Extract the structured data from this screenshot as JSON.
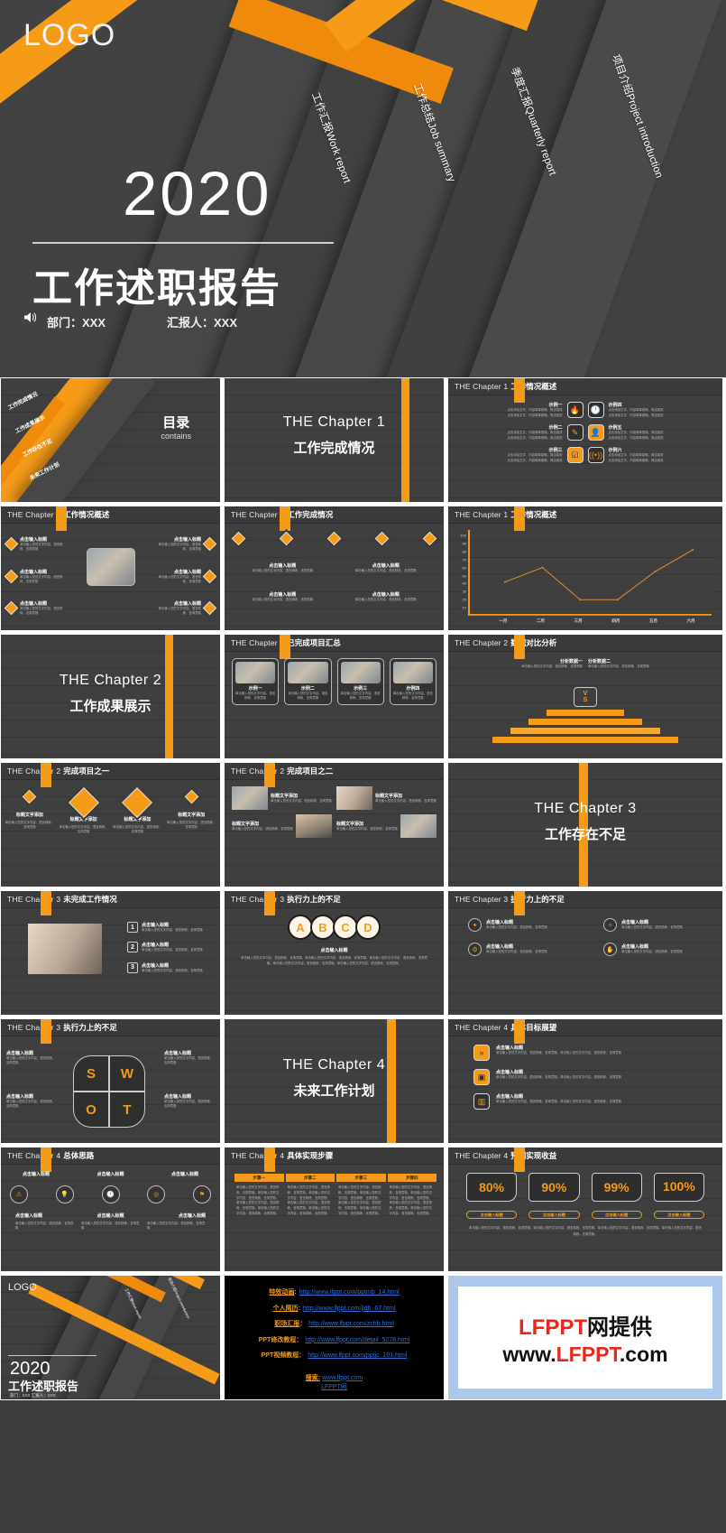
{
  "hero": {
    "logo": "LOGO",
    "year": "2020",
    "title": "工作述职报告",
    "dept_label": "部门：XXX",
    "reporter_label": "汇报人：XXX",
    "speaker_icon": "speaker-icon",
    "diagonal_labels": [
      "工作汇报Work report",
      "工作总结Job summary",
      "季度汇报Quarterly report",
      "项目介绍Project introduction"
    ],
    "accent_color": "#F59B18",
    "bg_color": "#424242"
  },
  "slides": [
    {
      "kind": "toc",
      "heading_cn": "目录",
      "heading_en": "contains",
      "items": [
        "工作完成情况",
        "工作成果展示",
        "工作存在不足",
        "未来工作计划"
      ]
    },
    {
      "kind": "chapter",
      "en": "THE Chapter 1",
      "cn": "工作完成情况"
    },
    {
      "kind": "overview-6",
      "chapter": "THE Chapter 1",
      "title": "工作情况概述",
      "items": [
        {
          "label": "示例一",
          "icon": "fire-icon",
          "body": "点击添加文字，内容简单易懂，简洁易改\n点击添加文字，内容简单易懂，简洁易改"
        },
        {
          "label": "示例二",
          "icon": "pencil-icon",
          "body": "点击添加文字，内容简单易懂，简洁易改\n点击添加文字，内容简单易懂，简洁易改"
        },
        {
          "label": "示例三",
          "icon": "checklist-icon",
          "body": "点击添加文字，内容简单易懂，简洁易改\n点击添加文字，内容简单易懂，简洁易改"
        },
        {
          "label": "示例四",
          "icon": "clock-24h-icon",
          "body": "点击添加文字，内容简单易懂，简洁易改\n点击添加文字，内容简单易懂，简洁易改"
        },
        {
          "label": "示例五",
          "icon": "user-check-icon",
          "body": "点击添加文字，内容简单易懂，简洁易改\n点击添加文字，内容简单易懂，简洁易改"
        },
        {
          "label": "示例六",
          "icon": "wifi-signal-icon",
          "body": "点击添加文字，内容简单易懂，简洁易改\n点击添加文字，内容简单易懂，简洁易改"
        }
      ]
    },
    {
      "kind": "diamond-4-photo",
      "chapter": "THE Chapter 1",
      "title": "工作情况概述",
      "item_title": "点击输入标题",
      "item_body": "单击输入您的文字内容，语言精练、言简意赅",
      "photo": "laptop-desk-photo"
    },
    {
      "kind": "diamond-row-5",
      "chapter": "THE Chapter 1",
      "title": "工作完成情况",
      "item_title": "点击输入标题",
      "item_body": "单击输入您的文字内容，语言精练、言简意赅"
    },
    {
      "kind": "line-chart",
      "chapter": "THE Chapter 1",
      "title": "工作情况概述"
    },
    {
      "kind": "chapter",
      "en": "THE Chapter 2",
      "cn": "工作成果展示"
    },
    {
      "kind": "cards-4",
      "chapter": "THE Chapter 2",
      "title": "已完成项目汇总",
      "cards": [
        {
          "label": "示例一",
          "photo": "city-desk-photo"
        },
        {
          "label": "示例二",
          "photo": "city-desk-photo"
        },
        {
          "label": "示例三",
          "photo": "city-desk-photo"
        },
        {
          "label": "示例四",
          "photo": "city-desk-photo"
        }
      ],
      "card_body": "单击输入您的文字内容，语言精练、言简意赅"
    },
    {
      "kind": "funnel",
      "chapter": "THE Chapter 2",
      "title": "数据对比分析",
      "col1_title": "分析数据一",
      "col2_title": "分析数据二",
      "col_body": "单击输入您的文字内容，语言精练、言简意赅",
      "center_letters": [
        "V",
        "S"
      ]
    },
    {
      "kind": "icon-4",
      "chapter": "THE Chapter 2",
      "title": "完成项目之一",
      "items": [
        {
          "icon": "diamond-small-icon",
          "title": "标题文字添加",
          "body": "单击输入您的文字内容，语言精练、言简意赅"
        },
        {
          "icon": "tag-money-icon",
          "title": "标题文字添加",
          "body": "单击输入您的文字内容，语言精练、言简意赅"
        },
        {
          "icon": "grid-dots-icon",
          "title": "标题文字添加",
          "body": "单击输入您的文字内容，语言精练、言简意赅"
        },
        {
          "icon": "diamond-small-icon",
          "title": "标题文字添加",
          "body": "单击输入您的文字内容，语言精练、言简意赅"
        }
      ]
    },
    {
      "kind": "photo-grid-4",
      "chapter": "THE Chapter 2",
      "title": "完成项目之二",
      "items": [
        {
          "title": "标题文字添加",
          "body": "单击输入您的文字内容，语言精练、言简意赅",
          "photo": "office-meeting-photo"
        },
        {
          "title": "标题文字添加",
          "body": "单击输入您的文字内容，语言精练、言简意赅",
          "photo": "team-photo"
        },
        {
          "title": "标题文字添加",
          "body": "单击输入您的文字内容，语言精练、言简意赅",
          "photo": "sunset-desk-photo"
        },
        {
          "title": "标题文字添加",
          "body": "单击输入您的文字内容，语言精练、言简意赅",
          "photo": "tablet-hands-photo"
        }
      ]
    },
    {
      "kind": "chapter",
      "en": "THE Chapter 3",
      "cn": "工作存在不足"
    },
    {
      "kind": "numbered-3-photo",
      "chapter": "THE Chapter 3",
      "title": "未完成工作情况",
      "photo": "writing-hands-photo",
      "items": [
        {
          "num": "1",
          "title": "点击输入标题",
          "body": "单击输入您的文字内容，语言精练、言简意赅"
        },
        {
          "num": "2",
          "title": "点击输入标题",
          "body": "单击输入您的文字内容，语言精练、言简意赅"
        },
        {
          "num": "3",
          "title": "点击输入标题",
          "body": "单击输入您的文字内容，语言精练、言简意赅"
        }
      ]
    },
    {
      "kind": "abcd",
      "chapter": "THE Chapter 3",
      "title": "执行力上的不足",
      "letters": [
        "A",
        "B",
        "C",
        "D"
      ],
      "body_title": "点击输入标题",
      "body": "单击输入您的文字内容，语言精练、言简意赅。单击输入您的文字内容，语言精练、言简意赅。单击输入您的文字内容，语言精练、言简意赅。单击输入您的文字内容，语言精练、言简意赅。单击输入您的文字内容，语言精练、言简意赅。"
    },
    {
      "kind": "circ-icons-4",
      "chapter": "THE Chapter 3",
      "title": "执行力上的不足",
      "items": [
        {
          "icon": "puzzle-icon",
          "title": "点击输入标题",
          "body": "单击输入您的文字内容，语言精练、言简意赅"
        },
        {
          "icon": "gears-icon",
          "title": "点击输入标题",
          "body": "单击输入您的文字内容，语言精练、言简意赅"
        },
        {
          "icon": "handshake-icon",
          "title": "点击输入标题",
          "body": "单击输入您的文字内容，语言精练、言简意赅"
        },
        {
          "icon": "hand-idea-icon",
          "title": "点击输入标题",
          "body": "单击输入您的文字内容，语言精练、言简意赅"
        }
      ]
    },
    {
      "kind": "swot",
      "chapter": "THE Chapter 3",
      "title": "执行力上的不足",
      "letters": [
        "S",
        "W",
        "O",
        "T"
      ],
      "item_title": "点击输入标题",
      "item_body": "单击输入您的文字内容，语言精练、言简意赅"
    },
    {
      "kind": "chapter",
      "en": "THE Chapter 4",
      "cn": "未来工作计划"
    },
    {
      "kind": "target-list-3",
      "chapter": "THE Chapter 4",
      "title": "具体目标展望",
      "items": [
        {
          "icon": "double-chevron-icon",
          "title": "点击输入标题",
          "body": "单击输入您的文字内容，语言精练、言简意赅。单击输入您的文字内容，语言精练、言简意赅"
        },
        {
          "icon": "archive-box-icon",
          "title": "点击输入标题",
          "body": "单击输入您的文字内容，语言精练、言简意赅。单击输入您的文字内容，语言精练、言简意赅"
        },
        {
          "icon": "bar-chart-icon",
          "title": "点击输入标题",
          "body": "单击输入您的文字内容，语言精练、言简意赅。单击输入您的文字内容，语言精练、言简意赅"
        }
      ]
    },
    {
      "kind": "thought-3",
      "chapter": "THE Chapter 4",
      "title": "总体思路",
      "items": [
        {
          "title": "点击输入标题",
          "icon": "alert-icon"
        },
        {
          "title": "点击输入标题",
          "icon": "lightbulb-icon"
        },
        {
          "title": "点击输入标题",
          "icon": "target-icon"
        }
      ],
      "extra_icons": [
        "clock-icon",
        "flag-icon"
      ],
      "sub_title": "点击输入标题",
      "sub_body": "单击输入您的文字内容，语言精练、言简意赅"
    },
    {
      "kind": "steps-4",
      "chapter": "THE Chapter 4",
      "title": "具体实现步骤",
      "steps": [
        "步骤一",
        "步骤二",
        "步骤三",
        "步骤四"
      ],
      "step_body": "单击输入您的文字内容，语言精练、言简意赅。单击输入您的文字内容，语言精练、言简意赅。单击输入您的文字内容，语言精练、言简意赅。单击输入您的文字内容，语言精练、言简意赅。"
    },
    {
      "kind": "percent-4",
      "chapter": "THE Chapter 4",
      "title": "预期实现收益",
      "percents": [
        "80%",
        "90%",
        "99%",
        "100%"
      ],
      "btn_label": "点击输入标题",
      "body": "单击输入您的文字内容，语言精练、言简意赅。单击输入您的文字内容，语言精练、言简意赅。单击输入您的文字内容，语言精练、言简意赅。单击输入您的文字内容，语言精练、言简意赅。"
    }
  ],
  "chart_data": {
    "type": "line",
    "title": "工作情况概述",
    "categories": [
      "一月",
      "二月",
      "三月",
      "四月",
      "五月",
      "六月"
    ],
    "values": [
      42,
      60,
      20,
      20,
      55,
      82
    ],
    "yticks": [
      100,
      90,
      80,
      70,
      60,
      50,
      40,
      30,
      20,
      10
    ],
    "ylim": [
      0,
      100
    ],
    "xlabel": "",
    "ylabel": "",
    "grid": true,
    "legend": "none",
    "series_color": "#D98A2B"
  },
  "footer": {
    "end_slide": {
      "logo": "LOGO",
      "year": "2020",
      "title": "工作述职报告",
      "meta": "部门：XXX    汇报人：XXX",
      "diagonal_labels": [
        "工作汇报Work report",
        "项目介绍Project introduction"
      ]
    },
    "links": [
      {
        "key": "特效动画",
        "sep": ":",
        "url": "http://www.lfppt.com/pptmb_14.html",
        "key_is_link": true
      },
      {
        "key": "个人简历",
        "sep": ":",
        "url": "http://www.lfppt.com/jldb_67.html",
        "key_is_link": true
      },
      {
        "key": "职场汇报",
        "sep": "：",
        "url": "http://www.lfppt.com/zchb.html",
        "key_is_link": true
      },
      {
        "key": "PPT修改教程",
        "sep": "：",
        "url": "http://www.lfppt.com/detail_5278.html",
        "key_is_link": false
      },
      {
        "key": "PPT视频教程",
        "sep": "：",
        "url": "http://www.lfppt.com/pptjc_101.html",
        "key_is_link": false
      }
    ],
    "search": {
      "label": "搜索:",
      "site": "www.lfppt.com",
      "brand": "LFPPT网"
    },
    "watermark": {
      "line1_red": "LFPPT",
      "line1_black": "网提供",
      "line2_pre": "www.",
      "line2_red": "LFPPT",
      "line2_post": ".com",
      "border_color": "#adc6ec",
      "red": "#e8271d"
    }
  }
}
